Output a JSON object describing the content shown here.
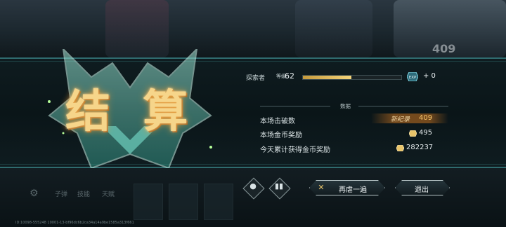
{
  "background": {
    "top_badge": "409"
  },
  "title": "结 算",
  "player": {
    "role_label": "探索者",
    "level_tag": "等级",
    "level": "62",
    "xp_fraction": 0.49,
    "exp_icon": "exp-icon",
    "exp_gain": "+ 0"
  },
  "stats": {
    "section_title": "数据",
    "rows": [
      {
        "label": "本场击破数",
        "badge": "新纪录",
        "value": "409"
      },
      {
        "label": "本场金币奖励",
        "value": "495"
      },
      {
        "label": "今天累计获得金币奖励",
        "value": "282237"
      }
    ]
  },
  "bottom": {
    "dim_labels": [
      "子弹",
      "技能",
      "天赋"
    ],
    "replay_icon": "camera-icon",
    "stats_icon": "bars-icon",
    "retry_label": "再虐一遍",
    "exit_label": "退出",
    "footer_id": "ID:10098-555248 10001-13-bf96dc6b2ca34a14a9be1585a313f661"
  },
  "colors": {
    "accent_gold": "#f6d58a",
    "panel_border": "#2f6b6e",
    "xp_fill": "#f4d47a"
  }
}
